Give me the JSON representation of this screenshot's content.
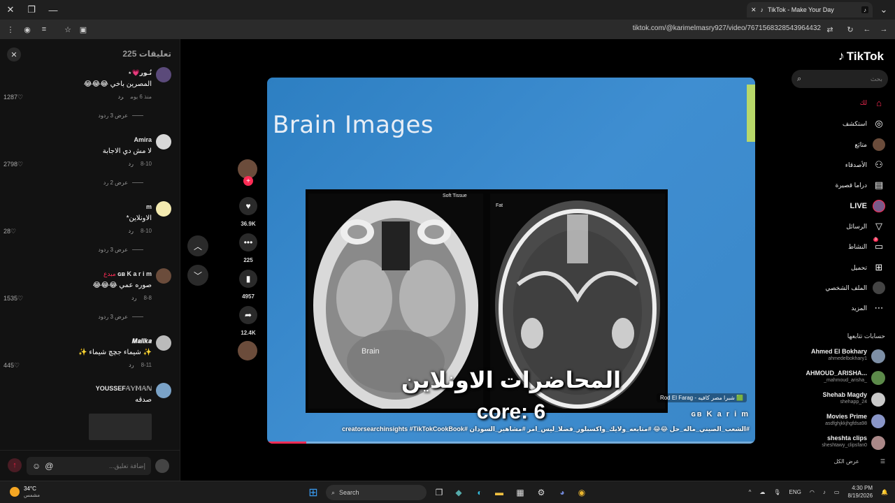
{
  "browser": {
    "tab_title": "TikTok - Make Your Day",
    "url": "tiktok.com/@karimelmasry927/video/7671568328543964432"
  },
  "comments_panel": {
    "title": "تعليقات",
    "count": "225",
    "items": [
      {
        "name": "نُـور💗⋆",
        "text": "المصرين باخي 😂😂😂",
        "date": "منذ 6 يوم",
        "reply": "رد",
        "likes": "1287",
        "more": "عرض 3 ردود"
      },
      {
        "name": "Amira",
        "text": "لا مش دي الاجابة",
        "date": "8-10",
        "reply": "رد",
        "likes": "2798",
        "more": "عرض 2 رد"
      },
      {
        "name": "m",
        "text": "الاونلاين*",
        "date": "8-10",
        "reply": "رد",
        "likes": "28",
        "more": "عرض 3 ردود"
      },
      {
        "name": "ɢʙ K a r i m",
        "creator": "مبدع",
        "text": "صوره عمي 😂😂😂",
        "date": "8-8",
        "reply": "رد",
        "likes": "1535",
        "more": "عرض 3 ردود"
      },
      {
        "name": "𝑴𝒂𝒍𝒊𝒌𝒂",
        "text": "✨ شيماء جچچ شيماء ✨",
        "date": "8-11",
        "reply": "رد",
        "likes": "445",
        "more": ""
      },
      {
        "name": "YOUSSEF𝔸𝕐𝕄𝔸ℕ",
        "text": "صدقه",
        "date": "",
        "reply": "",
        "likes": "",
        "more": ""
      }
    ],
    "input_placeholder": "إضافة تعليق..."
  },
  "actions": {
    "likes": "36.9K",
    "comments": "225",
    "saves": "4957",
    "shares": "12.4K"
  },
  "video": {
    "slide_title": "Brain Images",
    "ct_left_label": "Brain",
    "ct_left_corner": "Soft Tissue",
    "ct_right_corner": "Fat",
    "caption": "المحاضرات الاونلاين",
    "core_text": "core: 6",
    "audio": "🟩 شبرا مصر كافيه - Rod El Farag",
    "author": "ɢʙ K a r i m",
    "hashtags": "#الشعب_الصيني_ماله_حل 😂😂 #متابعه_ولايك_واكسبلور_فضلا_ليس_امر #مشاهير_السودان #creatorsearchinsights #TikTokCookBook",
    "progress": 0.08
  },
  "sidebar": {
    "logo": "TikTok",
    "search_placeholder": "بحث",
    "nav": [
      {
        "label": "لك",
        "icon": "home-icon",
        "active": true
      },
      {
        "label": "استكشف",
        "icon": "compass-icon"
      },
      {
        "label": "متابَع",
        "icon": "following-icon"
      },
      {
        "label": "الأصدقاء",
        "icon": "friends-icon"
      },
      {
        "label": "دراما قصيرة",
        "icon": "drama-icon"
      },
      {
        "label": "LIVE",
        "icon": "live-icon"
      },
      {
        "label": "الرسائل",
        "icon": "messages-icon"
      },
      {
        "label": "النشاط",
        "icon": "activity-icon",
        "badge": "3"
      },
      {
        "label": "تحميل",
        "icon": "upload-icon"
      },
      {
        "label": "الملف الشخصي",
        "icon": "profile-icon"
      },
      {
        "label": "المزيد",
        "icon": "more-icon"
      }
    ],
    "following_title": "حسابات تتابعها",
    "following": [
      {
        "name": "Ahmed El Bokhary",
        "user": "ahmedelbokhary1"
      },
      {
        "name": "AHMOUD_ARISHA...",
        "user": "_mahmoud_arisha_"
      },
      {
        "name": "Shehab Magdy",
        "user": "shehapp_24"
      },
      {
        "name": "Movies Prime",
        "user": "asdfghjkkjhgfdsa98"
      },
      {
        "name": "sheshta clips",
        "user": "sheshtawy_clipsfan0"
      }
    ],
    "see_all": "عرض الكل"
  },
  "taskbar": {
    "temp": "34°C",
    "condition": "مشمس",
    "search": "Search",
    "lang": "ENG",
    "time": "4:30 PM",
    "date": "8/19/2026"
  }
}
